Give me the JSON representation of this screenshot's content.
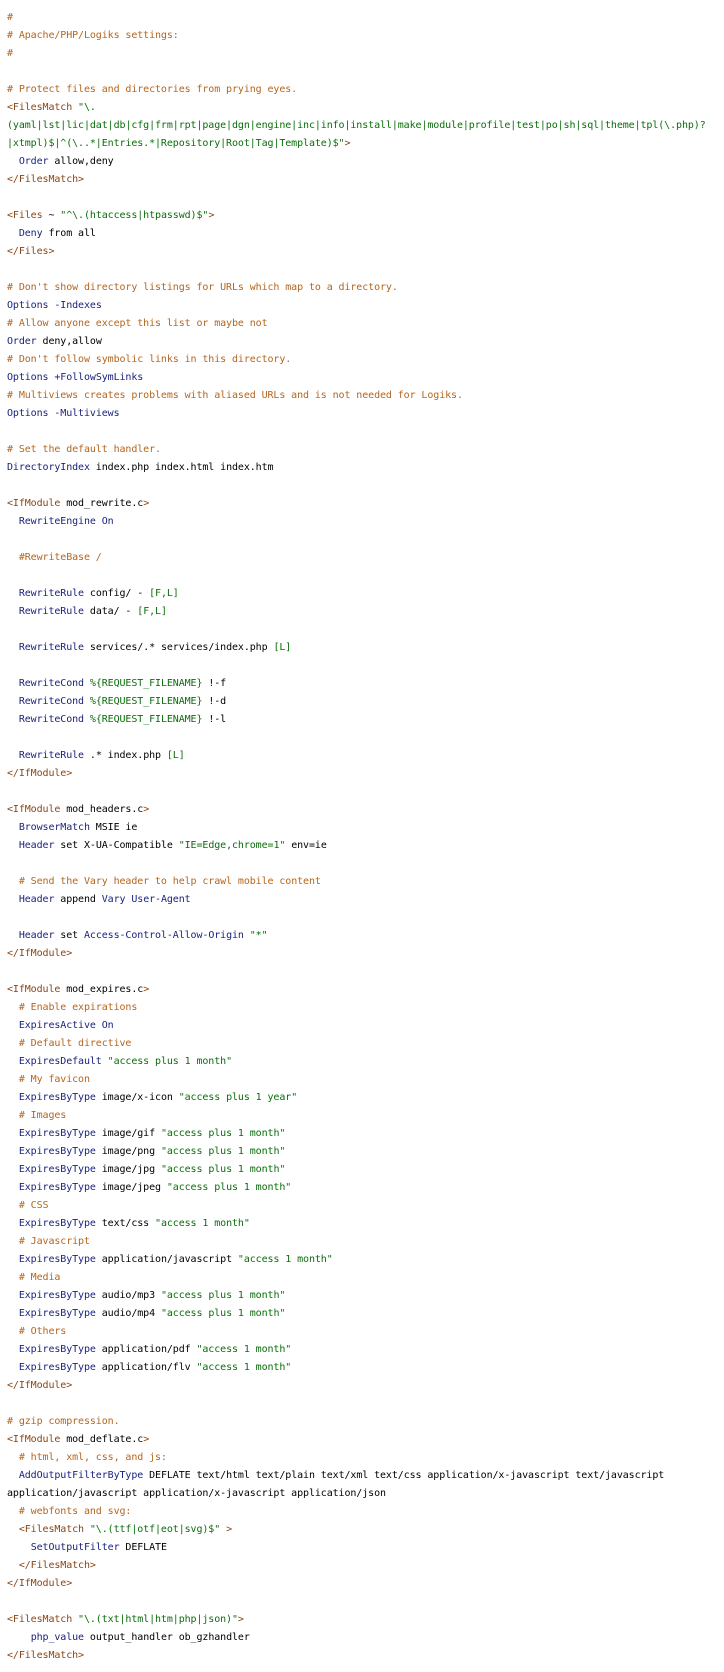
{
  "colors": {
    "comment": "#b5651d",
    "tag": "#8b4513",
    "directive": "#1a237e",
    "string": "#0a6e0a",
    "text": "#000000",
    "background": "#ffffff"
  },
  "lines": [
    [
      [
        "c",
        "#"
      ]
    ],
    [
      [
        "c",
        "# Apache/PHP/Logiks settings:"
      ]
    ],
    [
      [
        "c",
        "#"
      ]
    ],
    [],
    [
      [
        "c",
        "# Protect files and directories from prying eyes."
      ]
    ],
    [
      [
        "tag",
        "<FilesMatch "
      ],
      [
        "s",
        "\"\\."
      ]
    ],
    [
      [
        "s",
        "(yaml|lst|lic|dat|db|cfg|frm|rpt|page|dgn|engine|inc|info|install|make|module|profile|test|po|sh|sql|theme|tpl(\\.php)?"
      ]
    ],
    [
      [
        "s",
        "|xtmpl)$|^(\\..*|Entries.*|Repository|Root|Tag|Template)$\""
      ],
      [
        "tag",
        ">"
      ]
    ],
    [
      [
        "v",
        "  "
      ],
      [
        "k",
        "Order"
      ],
      [
        "v",
        " allow,deny"
      ]
    ],
    [
      [
        "tag",
        "</FilesMatch>"
      ]
    ],
    [],
    [
      [
        "tag",
        "<Files "
      ],
      [
        "v",
        "~ "
      ],
      [
        "s",
        "\"^\\.(htaccess|htpasswd)$\""
      ],
      [
        "tag",
        ">"
      ]
    ],
    [
      [
        "v",
        "  "
      ],
      [
        "k",
        "Deny"
      ],
      [
        "v",
        " from all"
      ]
    ],
    [
      [
        "tag",
        "</Files>"
      ]
    ],
    [],
    [
      [
        "c",
        "# Don't show directory listings for URLs which map to a directory."
      ]
    ],
    [
      [
        "k",
        "Options"
      ],
      [
        "v",
        " "
      ],
      [
        "k",
        "-Indexes"
      ]
    ],
    [
      [
        "c",
        "# Allow anyone except this list or maybe not"
      ]
    ],
    [
      [
        "k",
        "Order"
      ],
      [
        "v",
        " deny,allow"
      ]
    ],
    [
      [
        "c",
        "# Don't follow symbolic links in this directory."
      ]
    ],
    [
      [
        "k",
        "Options"
      ],
      [
        "v",
        " "
      ],
      [
        "k",
        "+FollowSymLinks"
      ]
    ],
    [
      [
        "c",
        "# Multiviews creates problems with aliased URLs and is not needed for Logiks."
      ]
    ],
    [
      [
        "k",
        "Options"
      ],
      [
        "v",
        " "
      ],
      [
        "k",
        "-Multiviews"
      ]
    ],
    [],
    [
      [
        "c",
        "# Set the default handler."
      ]
    ],
    [
      [
        "k",
        "DirectoryIndex"
      ],
      [
        "v",
        " index.php index.html index.htm"
      ]
    ],
    [],
    [
      [
        "tag",
        "<IfModule "
      ],
      [
        "v",
        "mod_rewrite.c"
      ],
      [
        "tag",
        ">"
      ]
    ],
    [
      [
        "v",
        "  "
      ],
      [
        "k",
        "RewriteEngine"
      ],
      [
        "v",
        " "
      ],
      [
        "k",
        "On"
      ]
    ],
    [],
    [
      [
        "v",
        "  "
      ],
      [
        "c",
        "#RewriteBase /"
      ]
    ],
    [],
    [
      [
        "v",
        "  "
      ],
      [
        "k",
        "RewriteRule"
      ],
      [
        "v",
        " config/ - "
      ],
      [
        "s",
        "[F,L]"
      ]
    ],
    [
      [
        "v",
        "  "
      ],
      [
        "k",
        "RewriteRule"
      ],
      [
        "v",
        " data/ - "
      ],
      [
        "s",
        "[F,L]"
      ]
    ],
    [],
    [
      [
        "v",
        "  "
      ],
      [
        "k",
        "RewriteRule"
      ],
      [
        "v",
        " services/.* services/index.php "
      ],
      [
        "s",
        "[L]"
      ]
    ],
    [],
    [
      [
        "v",
        "  "
      ],
      [
        "k",
        "RewriteCond"
      ],
      [
        "v",
        " "
      ],
      [
        "s",
        "%{REQUEST_FILENAME}"
      ],
      [
        "v",
        " !-f"
      ]
    ],
    [
      [
        "v",
        "  "
      ],
      [
        "k",
        "RewriteCond"
      ],
      [
        "v",
        " "
      ],
      [
        "s",
        "%{REQUEST_FILENAME}"
      ],
      [
        "v",
        " !-d"
      ]
    ],
    [
      [
        "v",
        "  "
      ],
      [
        "k",
        "RewriteCond"
      ],
      [
        "v",
        " "
      ],
      [
        "s",
        "%{REQUEST_FILENAME}"
      ],
      [
        "v",
        " !-l"
      ]
    ],
    [],
    [
      [
        "v",
        "  "
      ],
      [
        "k",
        "RewriteRule"
      ],
      [
        "v",
        " .* index.php "
      ],
      [
        "s",
        "[L]"
      ]
    ],
    [
      [
        "tag",
        "</IfModule>"
      ]
    ],
    [],
    [
      [
        "tag",
        "<IfModule "
      ],
      [
        "v",
        "mod_headers.c"
      ],
      [
        "tag",
        ">"
      ]
    ],
    [
      [
        "v",
        "  "
      ],
      [
        "k",
        "BrowserMatch"
      ],
      [
        "v",
        " MSIE ie"
      ]
    ],
    [
      [
        "v",
        "  "
      ],
      [
        "k",
        "Header"
      ],
      [
        "v",
        " set X-UA-Compatible "
      ],
      [
        "s",
        "\"IE=Edge,chrome=1\""
      ],
      [
        "v",
        " env=ie"
      ]
    ],
    [],
    [
      [
        "v",
        "  "
      ],
      [
        "c",
        "# Send the Vary header to help crawl mobile content"
      ]
    ],
    [
      [
        "v",
        "  "
      ],
      [
        "k",
        "Header"
      ],
      [
        "v",
        " append "
      ],
      [
        "k",
        "Vary"
      ],
      [
        "v",
        " "
      ],
      [
        "k",
        "User-Agent"
      ]
    ],
    [],
    [
      [
        "v",
        "  "
      ],
      [
        "k",
        "Header"
      ],
      [
        "v",
        " set "
      ],
      [
        "k",
        "Access-Control-Allow-Origin"
      ],
      [
        "v",
        " "
      ],
      [
        "s",
        "\"*\""
      ]
    ],
    [
      [
        "tag",
        "</IfModule>"
      ]
    ],
    [],
    [
      [
        "tag",
        "<IfModule "
      ],
      [
        "v",
        "mod_expires.c"
      ],
      [
        "tag",
        ">"
      ]
    ],
    [
      [
        "v",
        "  "
      ],
      [
        "c",
        "# Enable expirations"
      ]
    ],
    [
      [
        "v",
        "  "
      ],
      [
        "k",
        "ExpiresActive"
      ],
      [
        "v",
        " "
      ],
      [
        "k",
        "On"
      ]
    ],
    [
      [
        "v",
        "  "
      ],
      [
        "c",
        "# Default directive"
      ]
    ],
    [
      [
        "v",
        "  "
      ],
      [
        "k",
        "ExpiresDefault"
      ],
      [
        "v",
        " "
      ],
      [
        "s",
        "\"access plus 1 month\""
      ]
    ],
    [
      [
        "v",
        "  "
      ],
      [
        "c",
        "# My favicon"
      ]
    ],
    [
      [
        "v",
        "  "
      ],
      [
        "k",
        "ExpiresByType"
      ],
      [
        "v",
        " image/x-icon "
      ],
      [
        "s",
        "\"access plus 1 year\""
      ]
    ],
    [
      [
        "v",
        "  "
      ],
      [
        "c",
        "# Images"
      ]
    ],
    [
      [
        "v",
        "  "
      ],
      [
        "k",
        "ExpiresByType"
      ],
      [
        "v",
        " image/gif "
      ],
      [
        "s",
        "\"access plus 1 month\""
      ]
    ],
    [
      [
        "v",
        "  "
      ],
      [
        "k",
        "ExpiresByType"
      ],
      [
        "v",
        " image/png "
      ],
      [
        "s",
        "\"access plus 1 month\""
      ]
    ],
    [
      [
        "v",
        "  "
      ],
      [
        "k",
        "ExpiresByType"
      ],
      [
        "v",
        " image/jpg "
      ],
      [
        "s",
        "\"access plus 1 month\""
      ]
    ],
    [
      [
        "v",
        "  "
      ],
      [
        "k",
        "ExpiresByType"
      ],
      [
        "v",
        " image/jpeg "
      ],
      [
        "s",
        "\"access plus 1 month\""
      ]
    ],
    [
      [
        "v",
        "  "
      ],
      [
        "c",
        "# CSS"
      ]
    ],
    [
      [
        "v",
        "  "
      ],
      [
        "k",
        "ExpiresByType"
      ],
      [
        "v",
        " text/css "
      ],
      [
        "s",
        "\"access 1 month\""
      ]
    ],
    [
      [
        "v",
        "  "
      ],
      [
        "c",
        "# Javascript"
      ]
    ],
    [
      [
        "v",
        "  "
      ],
      [
        "k",
        "ExpiresByType"
      ],
      [
        "v",
        " application/javascript "
      ],
      [
        "s",
        "\"access 1 month\""
      ]
    ],
    [
      [
        "v",
        "  "
      ],
      [
        "c",
        "# Media"
      ]
    ],
    [
      [
        "v",
        "  "
      ],
      [
        "k",
        "ExpiresByType"
      ],
      [
        "v",
        " audio/mp3 "
      ],
      [
        "s",
        "\"access plus 1 month\""
      ]
    ],
    [
      [
        "v",
        "  "
      ],
      [
        "k",
        "ExpiresByType"
      ],
      [
        "v",
        " audio/mp4 "
      ],
      [
        "s",
        "\"access plus 1 month\""
      ]
    ],
    [
      [
        "v",
        "  "
      ],
      [
        "c",
        "# Others"
      ]
    ],
    [
      [
        "v",
        "  "
      ],
      [
        "k",
        "ExpiresByType"
      ],
      [
        "v",
        " application/pdf "
      ],
      [
        "s",
        "\"access 1 month\""
      ]
    ],
    [
      [
        "v",
        "  "
      ],
      [
        "k",
        "ExpiresByType"
      ],
      [
        "v",
        " application/flv "
      ],
      [
        "s",
        "\"access 1 month\""
      ]
    ],
    [
      [
        "tag",
        "</IfModule>"
      ]
    ],
    [],
    [
      [
        "c",
        "# gzip compression."
      ]
    ],
    [
      [
        "tag",
        "<IfModule "
      ],
      [
        "v",
        "mod_deflate.c"
      ],
      [
        "tag",
        ">"
      ]
    ],
    [
      [
        "v",
        "  "
      ],
      [
        "c",
        "# html, xml, css, and js:"
      ]
    ],
    [
      [
        "v",
        "  "
      ],
      [
        "k",
        "AddOutputFilterByType"
      ],
      [
        "v",
        " DEFLATE text/html text/plain text/xml text/css application/x-javascript text/javascript"
      ]
    ],
    [
      [
        "v",
        "application/javascript application/x-javascript application/json"
      ]
    ],
    [
      [
        "v",
        "  "
      ],
      [
        "c",
        "# webfonts and svg:"
      ]
    ],
    [
      [
        "v",
        "  "
      ],
      [
        "tag",
        "<FilesMatch "
      ],
      [
        "s",
        "\"\\.(ttf|otf|eot|svg)$\""
      ],
      [
        "v",
        " "
      ],
      [
        "tag",
        ">"
      ]
    ],
    [
      [
        "v",
        "    "
      ],
      [
        "k",
        "SetOutputFilter"
      ],
      [
        "v",
        " DEFLATE"
      ]
    ],
    [
      [
        "v",
        "  "
      ],
      [
        "tag",
        "</FilesMatch>"
      ]
    ],
    [
      [
        "tag",
        "</IfModule>"
      ]
    ],
    [],
    [
      [
        "tag",
        "<FilesMatch "
      ],
      [
        "s",
        "\"\\.(txt|html|htm|php|json)\""
      ],
      [
        "tag",
        ">"
      ]
    ],
    [
      [
        "v",
        "    "
      ],
      [
        "k",
        "php_value"
      ],
      [
        "v",
        " output_handler ob_gzhandler"
      ]
    ],
    [
      [
        "tag",
        "</FilesMatch>"
      ]
    ]
  ]
}
